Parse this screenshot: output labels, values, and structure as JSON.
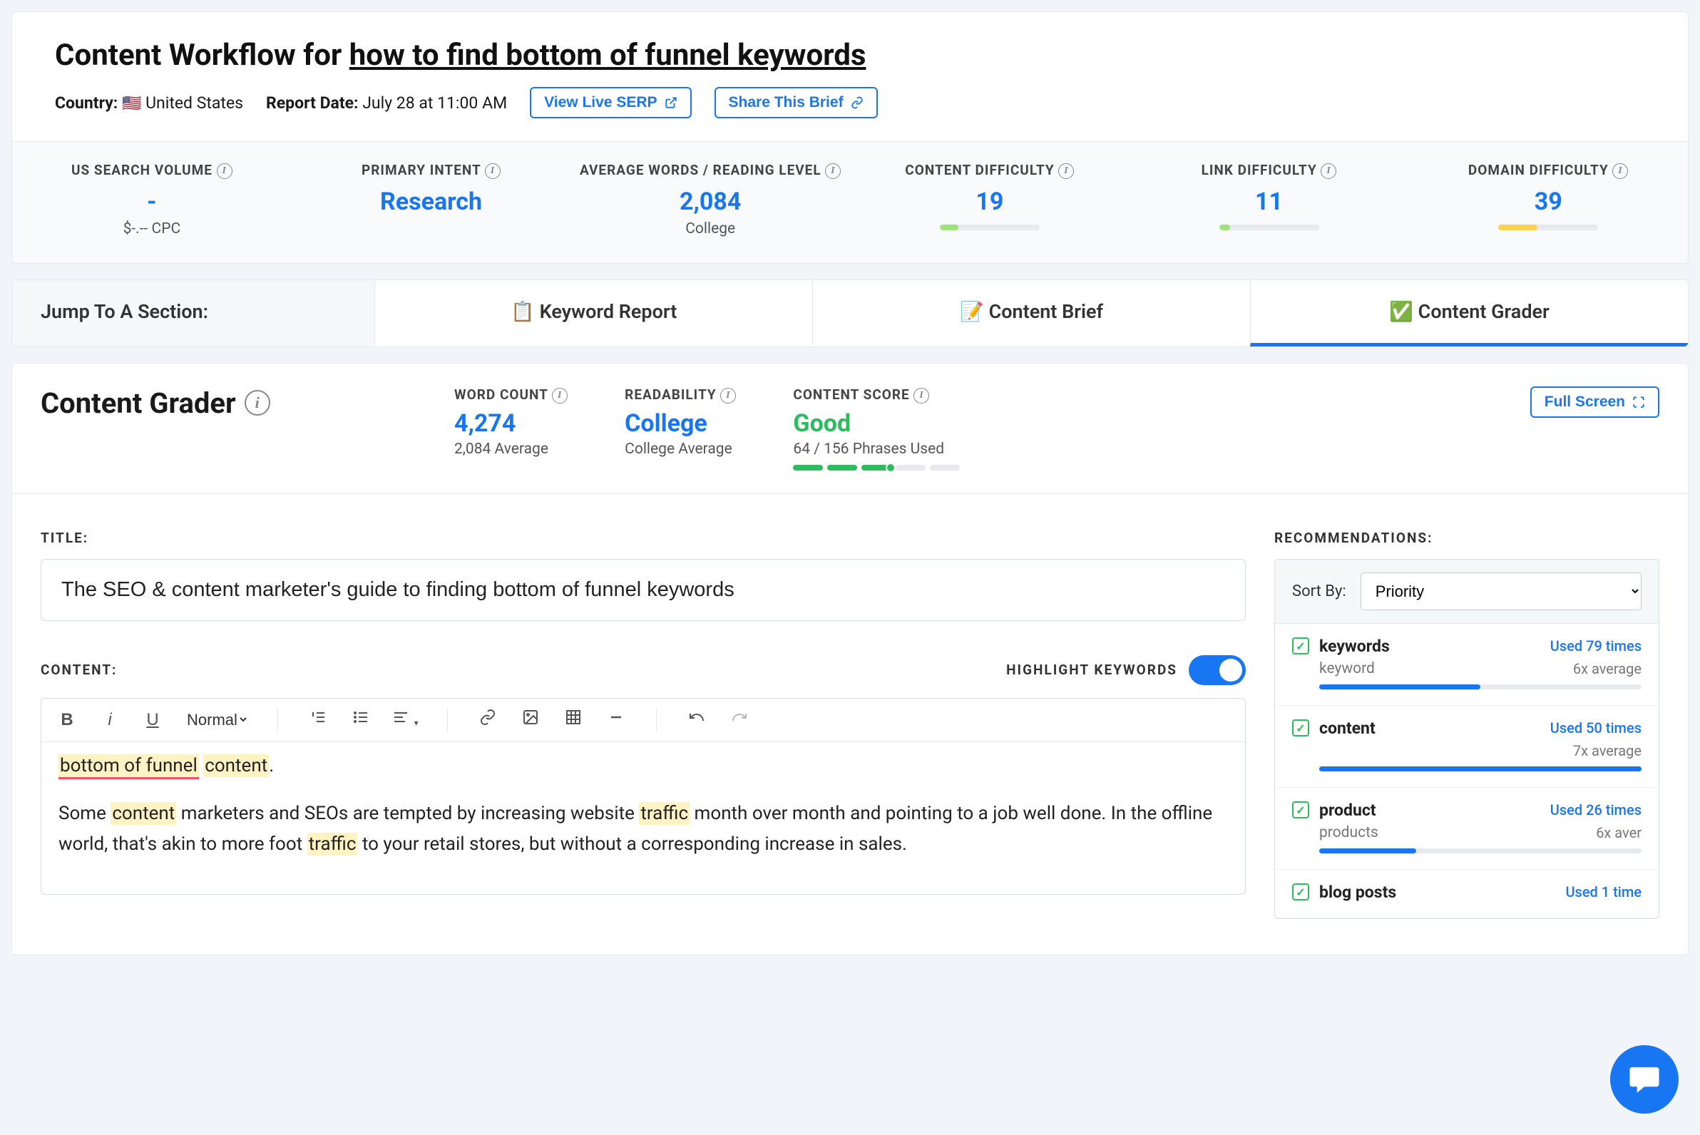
{
  "header": {
    "title_prefix": "Content Workflow for ",
    "keyword": "how to find bottom of funnel keywords",
    "country_label": "Country:",
    "country_value": "United States",
    "report_date_label": "Report Date:",
    "report_date_value": "July 28 at 11:00 AM",
    "view_serp_btn": "View Live SERP",
    "share_btn": "Share This Brief"
  },
  "metrics": [
    {
      "label": "US SEARCH VOLUME",
      "value": "-",
      "sub": "$-.-- CPC",
      "bar": null
    },
    {
      "label": "PRIMARY INTENT",
      "value": "Research",
      "sub": "",
      "bar": null
    },
    {
      "label": "AVERAGE WORDS / READING LEVEL",
      "value": "2,084",
      "sub": "College",
      "bar": null
    },
    {
      "label": "CONTENT DIFFICULTY",
      "value": "19",
      "sub": "",
      "bar": {
        "pct": 19,
        "color": "#9fe27a"
      }
    },
    {
      "label": "LINK DIFFICULTY",
      "value": "11",
      "sub": "",
      "bar": {
        "pct": 11,
        "color": "#9fe27a"
      }
    },
    {
      "label": "DOMAIN DIFFICULTY",
      "value": "39",
      "sub": "",
      "bar": {
        "pct": 39,
        "color": "#ffd24d"
      }
    }
  ],
  "tabs": {
    "jump_label": "Jump To A Section:",
    "items": [
      {
        "icon": "📋",
        "label": "Keyword Report",
        "active": false
      },
      {
        "icon": "📝",
        "label": "Content Brief",
        "active": false
      },
      {
        "icon": "✅",
        "label": "Content Grader",
        "active": true
      }
    ]
  },
  "grader": {
    "title": "Content Grader",
    "full_screen_btn": "Full Screen",
    "metrics": {
      "word_count": {
        "label": "WORD COUNT",
        "value": "4,274",
        "sub": "2,084 Average"
      },
      "readability": {
        "label": "READABILITY",
        "value": "College",
        "sub": "College Average"
      },
      "content_score": {
        "label": "CONTENT SCORE",
        "value": "Good",
        "sub": "64 / 156 Phrases Used",
        "segments_on": 3
      }
    }
  },
  "editor": {
    "title_label": "TITLE:",
    "title_value": "The SEO & content marketer's guide to finding bottom of funnel keywords",
    "content_label": "CONTENT:",
    "highlight_label": "HIGHLIGHT KEYWORDS",
    "format_select": "Normal",
    "body": {
      "p1_hl1": "bottom of funnel",
      "p1_hl2": "content",
      "p1_suffix": ".",
      "p2_pre": "Some ",
      "p2_hl1": "content",
      "p2_mid1": " marketers and SEOs are tempted by increasing website ",
      "p2_hl2": "traffic",
      "p2_mid2": " month over month and pointing to a job well done. In the offline world, that's akin to more foot ",
      "p2_hl3": "traffic",
      "p2_end": " to your retail stores, but without a corresponding increase in sales."
    }
  },
  "recommendations": {
    "label": "RECOMMENDATIONS:",
    "sort_label": "Sort By:",
    "sort_value": "Priority",
    "items": [
      {
        "term": "keywords",
        "used": "Used 79 times",
        "sub": "keyword",
        "avg": "6x average",
        "bar_pct": 50
      },
      {
        "term": "content",
        "used": "Used 50 times",
        "sub": "",
        "avg": "7x average",
        "bar_pct": 100
      },
      {
        "term": "product",
        "used": "Used 26 times",
        "sub": "products",
        "avg": "6x aver",
        "bar_pct": 30
      },
      {
        "term": "blog posts",
        "used": "Used 1 time",
        "sub": "",
        "avg": "",
        "bar_pct": 0
      }
    ]
  }
}
